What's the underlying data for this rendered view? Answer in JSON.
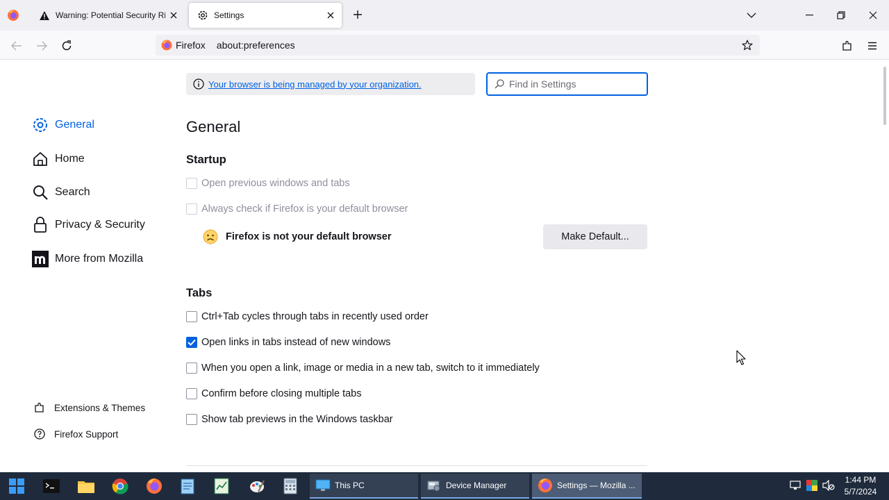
{
  "tabs": [
    {
      "label": "Warning: Potential Security Risk Ahead",
      "icon": "warning-icon"
    },
    {
      "label": "Settings",
      "icon": "gear-icon"
    }
  ],
  "urlbar": {
    "identity": "Firefox",
    "url": "about:preferences"
  },
  "sidebar": {
    "items": [
      {
        "label": "General",
        "icon": "gear-icon",
        "active": true
      },
      {
        "label": "Home",
        "icon": "home-icon"
      },
      {
        "label": "Search",
        "icon": "search-icon"
      },
      {
        "label": "Privacy & Security",
        "icon": "lock-icon"
      },
      {
        "label": "More from Mozilla",
        "icon": "mozilla-icon"
      }
    ],
    "footer": [
      {
        "label": "Extensions & Themes",
        "icon": "puzzle-icon"
      },
      {
        "label": "Firefox Support",
        "icon": "help-icon"
      }
    ]
  },
  "policy": {
    "text": "Your browser is being managed by your organization."
  },
  "search": {
    "placeholder": "Find in Settings"
  },
  "main": {
    "title": "General",
    "startup": {
      "heading": "Startup",
      "options": [
        {
          "label": "Open previous windows and tabs",
          "checked": false,
          "disabled": true
        },
        {
          "label": "Always check if Firefox is your default browser",
          "checked": false,
          "disabled": true
        }
      ],
      "default_status": "Firefox is not your default browser",
      "make_default_label": "Make Default..."
    },
    "tabs_section": {
      "heading": "Tabs",
      "options": [
        {
          "label": "Ctrl+Tab cycles through tabs in recently used order",
          "checked": false
        },
        {
          "label": "Open links in tabs instead of new windows",
          "checked": true
        },
        {
          "label": "When you open a link, image or media in a new tab, switch to it immediately",
          "checked": false
        },
        {
          "label": "Confirm before closing multiple tabs",
          "checked": false
        },
        {
          "label": "Show tab previews in the Windows taskbar",
          "checked": false
        }
      ]
    }
  },
  "taskbar": {
    "tasks": [
      {
        "label": "This PC"
      },
      {
        "label": "Device Manager"
      },
      {
        "label": "Settings — Mozilla ...",
        "active": true
      }
    ],
    "clock": {
      "time": "1:44 PM",
      "date": "5/7/2024"
    }
  },
  "colors": {
    "accent": "#0061e0",
    "taskbar": "#1f2b3c"
  }
}
